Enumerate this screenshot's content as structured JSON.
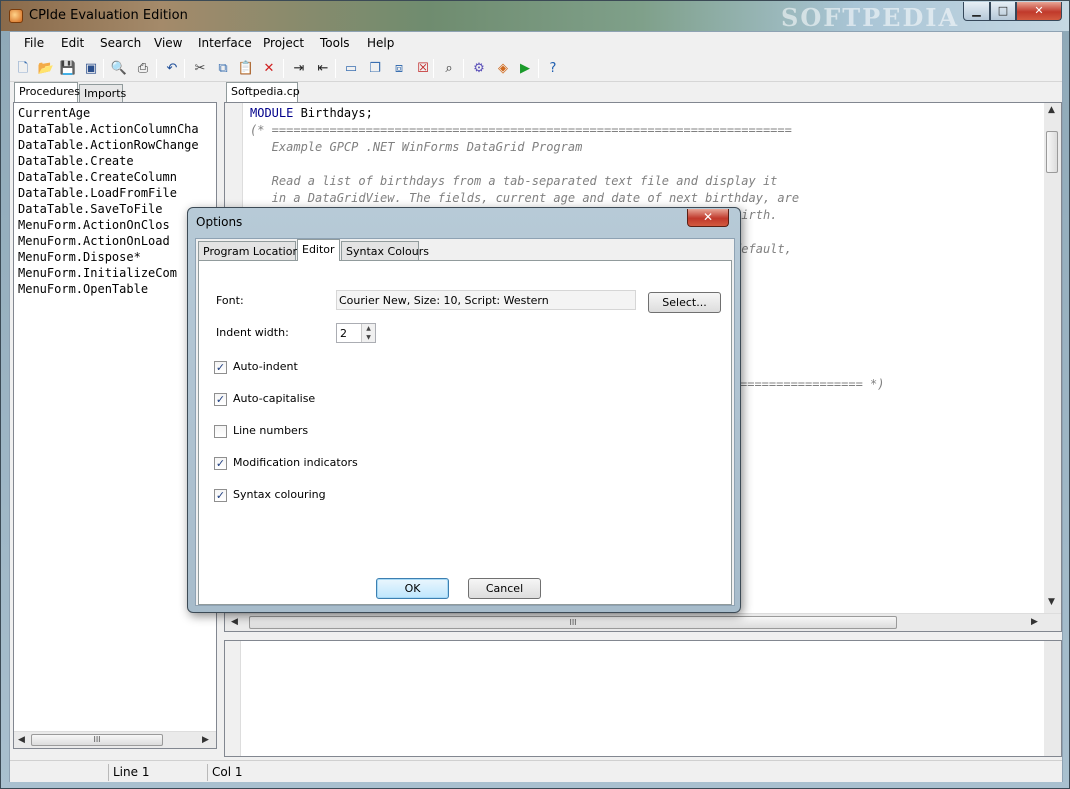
{
  "window": {
    "title": "CPIde Evaluation Edition",
    "watermark": "SOFTPEDIA",
    "min_glyph": "▁",
    "max_glyph": "□",
    "close_glyph": "✕"
  },
  "menubar": {
    "items": [
      "File",
      "Edit",
      "Search",
      "View",
      "Interface",
      "Project",
      "Tools",
      "Help"
    ]
  },
  "toolbar": {
    "icons": [
      {
        "name": "new-file-icon",
        "glyph": "🗋",
        "color": "#3a6fb0"
      },
      {
        "name": "open-folder-icon",
        "glyph": "📂",
        "color": "#d9a400"
      },
      {
        "name": "save-icon",
        "glyph": "💾",
        "color": "#2b4f8c"
      },
      {
        "name": "save-all-icon",
        "glyph": "▣",
        "color": "#2b4f8c"
      },
      {
        "name": "print-preview-icon",
        "glyph": "🔍",
        "color": "#555"
      },
      {
        "name": "print-icon",
        "glyph": "⎙",
        "color": "#333"
      },
      {
        "name": "undo-icon",
        "glyph": "↶",
        "color": "#1f4f9a"
      },
      {
        "name": "cut-icon",
        "glyph": "✂",
        "color": "#444"
      },
      {
        "name": "copy-icon",
        "glyph": "⧉",
        "color": "#3a6fb0"
      },
      {
        "name": "paste-icon",
        "glyph": "📋",
        "color": "#b07a1e"
      },
      {
        "name": "delete-icon",
        "glyph": "✕",
        "color": "#d02020"
      },
      {
        "name": "indent-icon",
        "glyph": "⇥",
        "color": "#222"
      },
      {
        "name": "outdent-icon",
        "glyph": "⇤",
        "color": "#222"
      },
      {
        "name": "window-icon",
        "glyph": "▭",
        "color": "#3a6fb0"
      },
      {
        "name": "window-stack-icon",
        "glyph": "❐",
        "color": "#3a6fb0"
      },
      {
        "name": "window-export-icon",
        "glyph": "⧈",
        "color": "#3a6fb0"
      },
      {
        "name": "window-close-icon",
        "glyph": "☒",
        "color": "#c02020"
      },
      {
        "name": "find-icon",
        "glyph": "⌕",
        "color": "#333"
      },
      {
        "name": "build-gear-icon",
        "glyph": "⚙",
        "color": "#5a4fb8"
      },
      {
        "name": "compile-icon",
        "glyph": "◈",
        "color": "#d06a1e"
      },
      {
        "name": "run-icon",
        "glyph": "▶",
        "color": "#1a9a2a"
      },
      {
        "name": "help-icon",
        "glyph": "?",
        "color": "#1f5fb0"
      }
    ]
  },
  "left_panel": {
    "tabs": [
      "Procedures",
      "Imports"
    ],
    "active_tab": "Procedures",
    "items": [
      "CurrentAge",
      "DataTable.ActionColumnCha",
      "DataTable.ActionRowChange",
      "DataTable.Create",
      "DataTable.CreateColumn",
      "DataTable.LoadFromFile",
      "DataTable.SaveToFile",
      "MenuForm.ActionOnClos",
      "MenuForm.ActionOnLoad",
      "MenuForm.Dispose*",
      "MenuForm.InitializeCom",
      "MenuForm.OpenTable"
    ],
    "scroll_thumb_label": "III"
  },
  "editor": {
    "tab": "Softpedia.cp",
    "lines": [
      {
        "kw": "MODULE",
        "text": " Birthdays;",
        "type": "code"
      },
      {
        "text": "(* ========================================================================",
        "type": "comment"
      },
      {
        "text": "   Example GPCP .NET WinForms DataGrid Program",
        "type": "comment"
      },
      {
        "text": "",
        "type": "comment"
      },
      {
        "text": "   Read a list of birthdays from a tab-separated text file and display it",
        "type": "comment"
      },
      {
        "text": "   in a DataGridView. The fields, current age and date of next birthday, are",
        "type": "comment"
      },
      {
        "text": "                                                                of birth.",
        "type": "comment"
      },
      {
        "text": "",
        "type": "comment"
      },
      {
        "text": "                                                              , by default,",
        "type": "comment"
      }
    ],
    "comment_end": "================= *)",
    "scroll_thumb_label": "III"
  },
  "statusbar": {
    "line": "Line 1",
    "col": "Col 1"
  },
  "dialog": {
    "title": "Options",
    "close_glyph": "✕",
    "tabs": [
      "Program Locations",
      "Editor",
      "Syntax Colours"
    ],
    "active_tab": "Editor",
    "font_label": "Font:",
    "font_value": "Courier New, Size: 10, Script: Western",
    "select_button": "Select...",
    "indent_label": "Indent width:",
    "indent_value": "2",
    "checkboxes": [
      {
        "label": "Auto-indent",
        "checked": true
      },
      {
        "label": "Auto-capitalise",
        "checked": true
      },
      {
        "label": "Line numbers",
        "checked": false
      },
      {
        "label": "Modification indicators",
        "checked": true
      },
      {
        "label": "Syntax colouring",
        "checked": true
      }
    ],
    "ok_button": "OK",
    "cancel_button": "Cancel"
  }
}
